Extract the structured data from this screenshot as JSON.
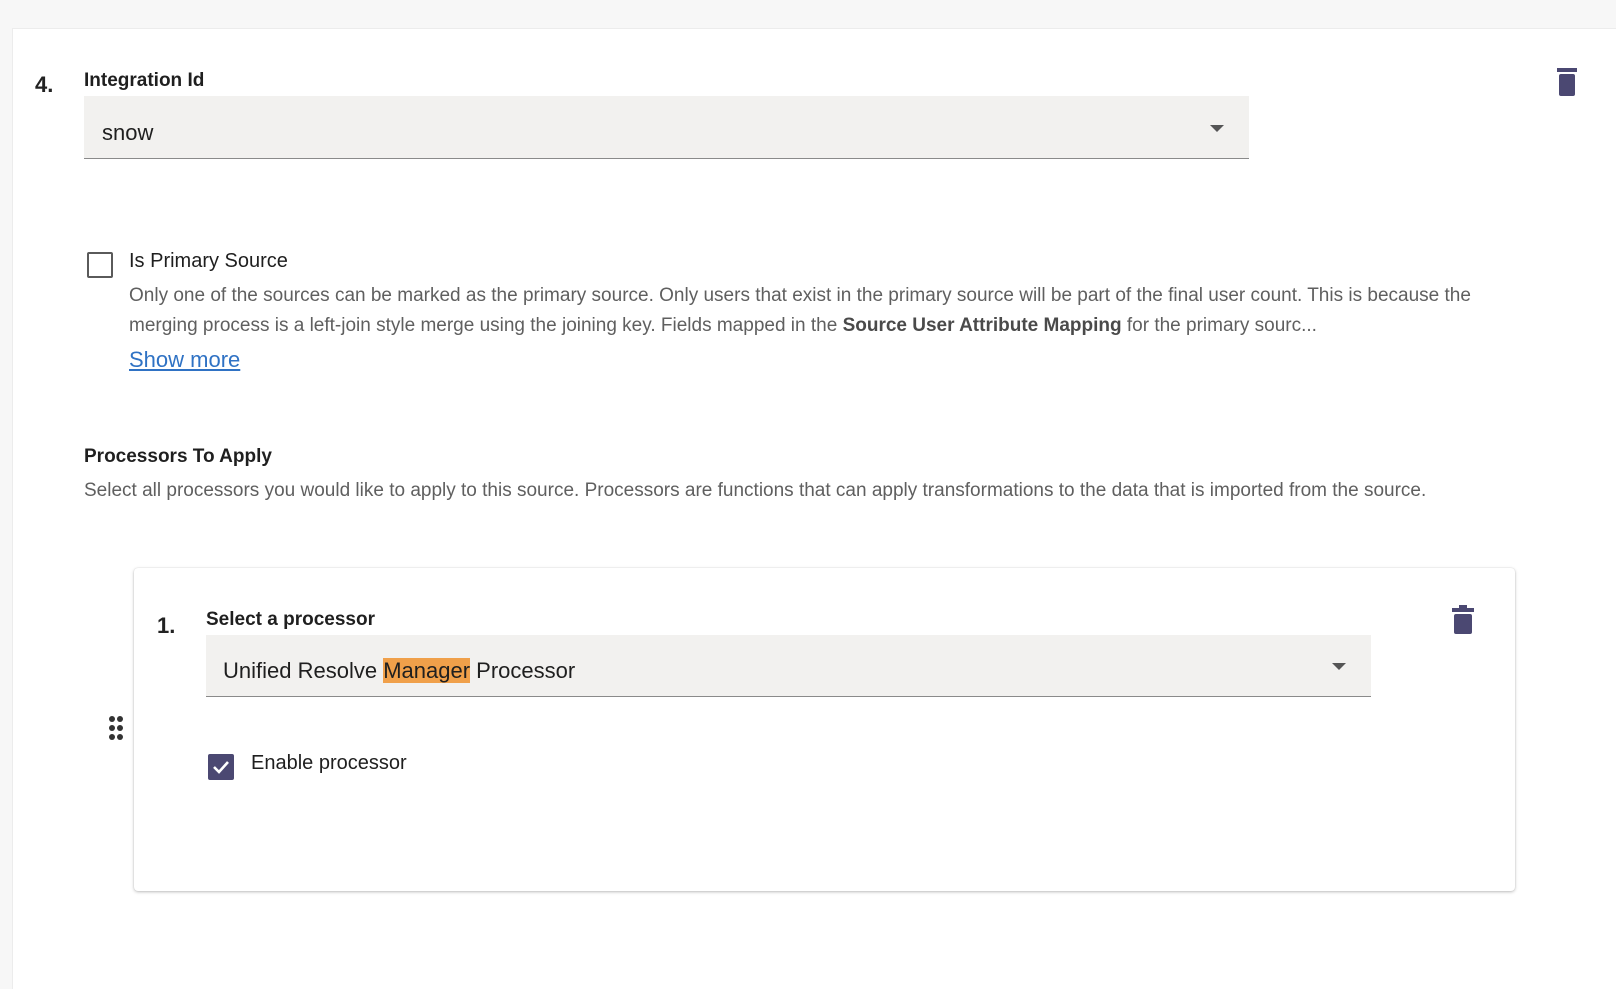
{
  "source": {
    "index": "4.",
    "integration_label": "Integration Id",
    "integration_value": "snow",
    "primary_label": "Is Primary Source",
    "primary_checked": false,
    "primary_desc_part1": "Only one of the sources can be marked as the primary source. Only users that exist in the primary source will be part of the final user count. This is because the merging process is a left-join style merge using the joining key. Fields mapped in the ",
    "primary_desc_bold": "Source User Attribute Mapping",
    "primary_desc_part2": " for the primary sourc...",
    "show_more": "Show more"
  },
  "processors": {
    "title": "Processors To Apply",
    "description": "Select all processors you would like to apply to this source. Processors are functions that can apply transformations to the data that is imported from the source.",
    "items": [
      {
        "index": "1.",
        "select_label": "Select a processor",
        "value_before": "Unified Resolve ",
        "value_highlight": "Manager",
        "value_after": " Processor",
        "enable_label": "Enable processor",
        "enabled": true
      }
    ]
  },
  "colors": {
    "accent": "#4b4872",
    "link": "#2f72c4",
    "highlight": "#f0a04a"
  },
  "icons": {
    "delete": "trash-icon",
    "drag": "drag-handle-icon",
    "dropdown": "chevron-down-icon",
    "check": "check-icon"
  }
}
